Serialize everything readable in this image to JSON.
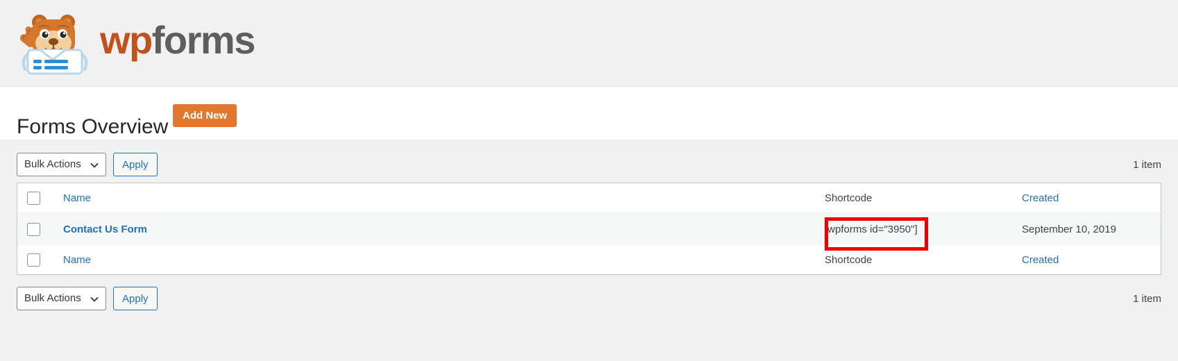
{
  "brand": {
    "logo_icon": "wpforms-bear-logo-icon",
    "name_part1": "wp",
    "name_part2": "forms"
  },
  "header": {
    "page_title": "Forms Overview",
    "add_new_label": "Add New"
  },
  "toolbar_top": {
    "bulk_actions_label": "Bulk Actions",
    "chevron_icon": "chevron-down-icon",
    "apply_label": "Apply",
    "item_count": "1 item"
  },
  "toolbar_bottom": {
    "bulk_actions_label": "Bulk Actions",
    "chevron_icon": "chevron-down-icon",
    "apply_label": "Apply",
    "item_count": "1 item"
  },
  "table": {
    "columns": {
      "name": "Name",
      "shortcode": "Shortcode",
      "created": "Created"
    },
    "rows": [
      {
        "name": "Contact Us Form",
        "shortcode": "[wpforms id=\"3950\"]",
        "created": "September 10, 2019"
      }
    ]
  },
  "annotation": {
    "target": "shortcode-cell",
    "color": "#ee0000"
  },
  "colors": {
    "accent_orange": "#e27730",
    "link_blue": "#2271b1",
    "chrome_grey": "#f1f1f1",
    "row_grey": "#f6f7f7",
    "annotation_red": "#ee0000"
  }
}
